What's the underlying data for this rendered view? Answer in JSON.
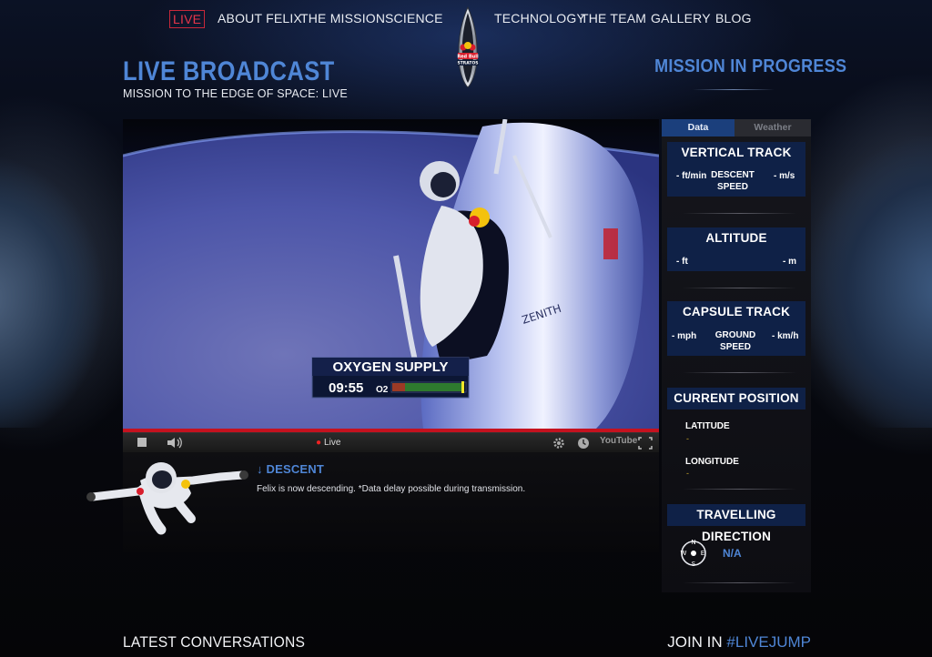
{
  "nav": {
    "items": [
      {
        "label": "LIVE",
        "active": true
      },
      {
        "label": "ABOUT FELIX"
      },
      {
        "label": "THE MISSION"
      },
      {
        "label": "SCIENCE"
      },
      {
        "label": "TECHNOLOGY"
      },
      {
        "label": "THE TEAM"
      },
      {
        "label": "GALLERY"
      },
      {
        "label": "BLOG"
      }
    ],
    "logo_text": "Red Bull STRATOS"
  },
  "header": {
    "title": "LIVE BROADCAST",
    "subtitle": "MISSION TO THE EDGE OF SPACE: LIVE",
    "status": "MISSION IN PROGRESS"
  },
  "video": {
    "overlay_label": "OXYGEN SUPPLY",
    "overlay_time": "09:55",
    "overlay_o2": "O2",
    "capsule_text": "ZENITH",
    "player": {
      "live_label": "Live",
      "youtube_label": "YouTube"
    }
  },
  "descent": {
    "label": "DESCENT",
    "text": "Felix is now descending. *Data delay possible during transmission."
  },
  "sidebar": {
    "tabs": [
      {
        "label": "Data",
        "active": true
      },
      {
        "label": "Weather"
      }
    ],
    "vertical_track": {
      "title": "VERTICAL TRACK",
      "left_value": "- ft/min",
      "center_label": "DESCENT SPEED",
      "right_value": "- m/s"
    },
    "altitude": {
      "title": "ALTITUDE",
      "left_value": "- ft",
      "right_value": "- m"
    },
    "capsule_track": {
      "title": "CAPSULE TRACK",
      "left_value": "- mph",
      "center_label": "GROUND SPEED",
      "right_value": "- km/h"
    },
    "current_position": {
      "title": "CURRENT POSITION",
      "latitude_label": "LATITUDE",
      "latitude_value": "-",
      "longitude_label": "LONGITUDE",
      "longitude_value": "-"
    },
    "travelling_direction": {
      "title": "TRAVELLING DIRECTION",
      "value": "N/A",
      "compass": {
        "n": "N",
        "e": "E",
        "s": "S",
        "w": "W"
      }
    }
  },
  "footer": {
    "latest": "LATEST CONVERSATIONS",
    "join_prefix": "JOIN IN ",
    "join_tag": "#LIVEJUMP"
  },
  "colors": {
    "accent": "#4f86d6",
    "live_red": "#e8354a",
    "panel_blue": "#0f2147"
  }
}
